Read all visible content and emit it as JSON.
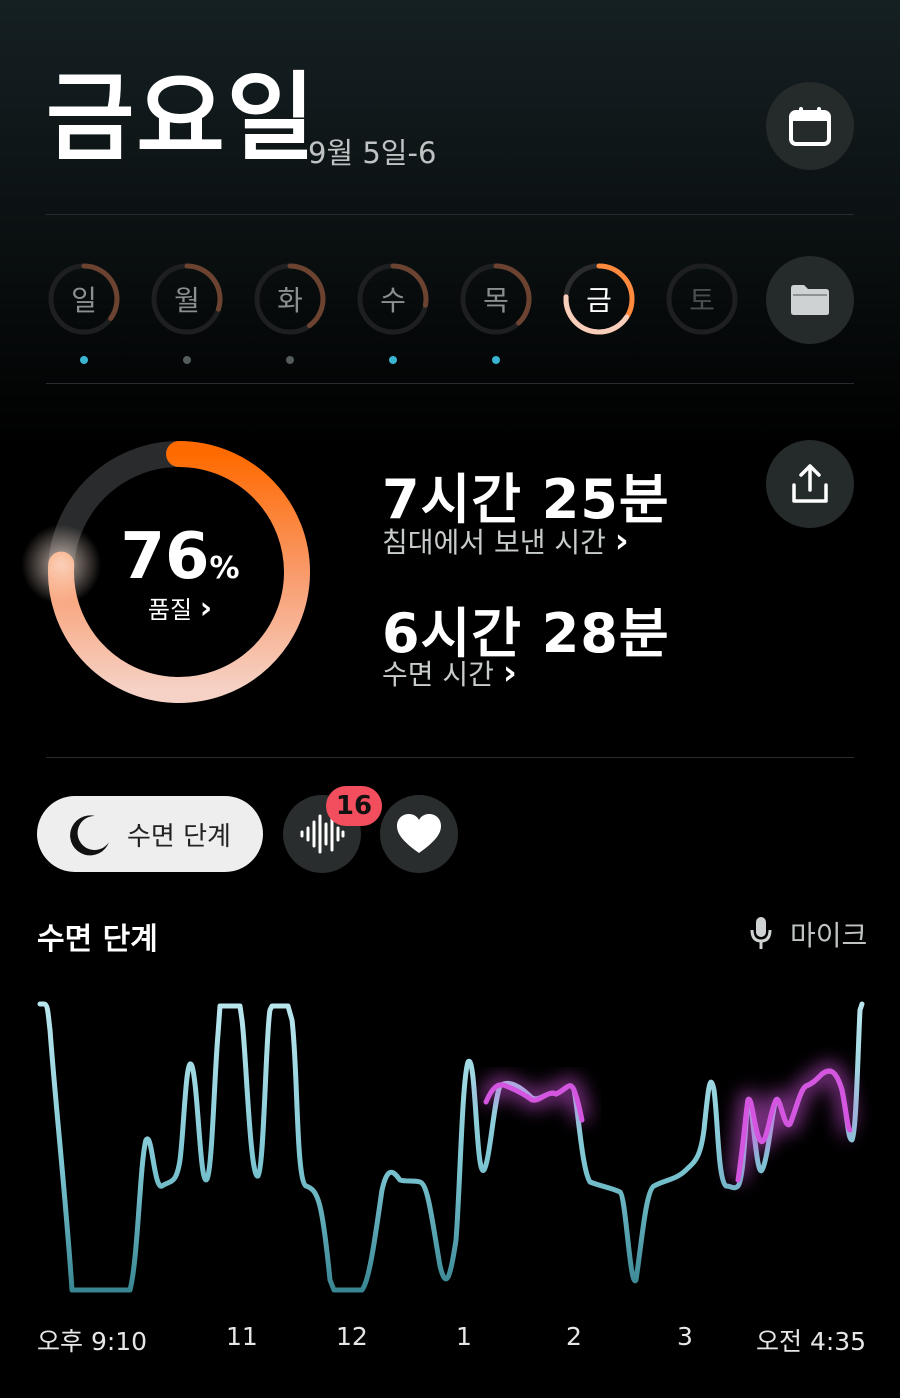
{
  "header": {
    "day_title": "금요일",
    "date_range": "9월 5일-6",
    "calendar_icon": "calendar-icon"
  },
  "week": {
    "days": [
      {
        "label": "일",
        "quality": 0.35,
        "has_data": true,
        "dot": "#3ab4d0"
      },
      {
        "label": "월",
        "quality": 0.3,
        "has_data": false,
        "dot": "#555a5b"
      },
      {
        "label": "화",
        "quality": 0.4,
        "has_data": false,
        "dot": "#555a5b"
      },
      {
        "label": "수",
        "quality": 0.28,
        "has_data": true,
        "dot": "#3ab4d0"
      },
      {
        "label": "목",
        "quality": 0.38,
        "has_data": true,
        "dot": "#3ab4d0"
      },
      {
        "label": "금",
        "quality": 0.76,
        "has_data": true,
        "selected": true,
        "dot": ""
      },
      {
        "label": "토",
        "quality": 0,
        "has_data": false,
        "dot": ""
      }
    ],
    "folder_icon": "folder-icon"
  },
  "summary": {
    "quality_percent": "76",
    "percent_sign": "%",
    "quality_label": "품질",
    "quality_value": 0.76,
    "time_in_bed": "7시간 25분",
    "time_in_bed_label": "침대에서 보낸 시간",
    "sleep_time": "6시간 28분",
    "sleep_time_label": "수면 시간",
    "share_icon": "share-icon",
    "chevron": "›"
  },
  "tabs": {
    "sleep_stages_label": "수면 단계",
    "moon_icon": "moon-icon",
    "audio_icon": "sound-wave-icon",
    "audio_badge": "16",
    "heart_icon": "heart-icon"
  },
  "stages": {
    "title": "수면 단계",
    "mic_label": "마이크",
    "mic_icon": "microphone-icon",
    "x_labels": [
      "오후 9:10",
      "11",
      "12",
      "1",
      "2",
      "3",
      "오전 4:35"
    ]
  },
  "colors": {
    "accent_orange": "#ff6a00",
    "ring_light": "#f7d5c8",
    "line_cyan": "#8fd3df",
    "line_deep": "#3a8b98",
    "rem_purple": "#d455e0"
  }
}
